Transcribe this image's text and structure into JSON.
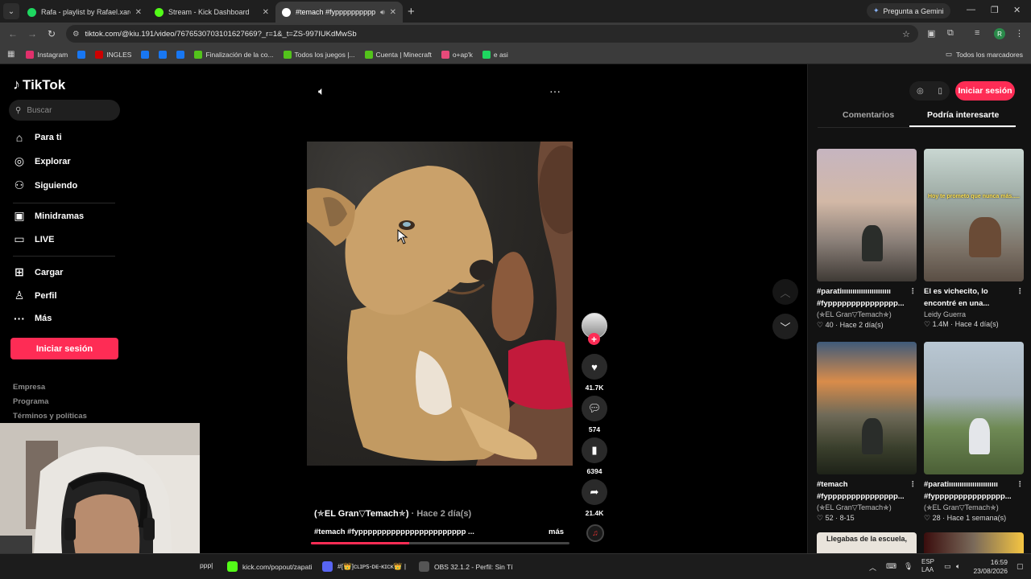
{
  "browser": {
    "tabs": [
      {
        "label": "Rafa - playlist by Rafael.xared |",
        "color": "#1ed760",
        "active": false
      },
      {
        "label": "Stream - Kick Dashboard",
        "color": "#53fc18",
        "active": false
      },
      {
        "label": "#temach #fypppppppppp",
        "color": "#ffffff",
        "active": true
      }
    ],
    "gemini_label": "Pregunta a Gemini",
    "url": "tiktok.com/@kiu.191/video/7676530703101627669?_r=1&_t=ZS-997IUKdMwSb",
    "profile_initial": "R",
    "bookmarks": [
      {
        "label": "Instagram",
        "color": "#e1306c"
      },
      {
        "label": "",
        "color": "#1877f2"
      },
      {
        "label": "INGLES",
        "color": "#cc0000"
      },
      {
        "label": "",
        "color": "#1877f2"
      },
      {
        "label": "",
        "color": "#1877f2"
      },
      {
        "label": "",
        "color": "#1877f2"
      },
      {
        "label": "Finalización de la co...",
        "color": "#53c31b"
      },
      {
        "label": "Todos los juegos |...",
        "color": "#53c31b"
      },
      {
        "label": "Cuenta | Minecraft",
        "color": "#53c31b"
      },
      {
        "label": "o+ap'k",
        "color": "#e84a7a"
      },
      {
        "label": "e asi",
        "color": "#1ed760"
      }
    ],
    "all_bookmarks": "Todos los marcadores"
  },
  "sidebar": {
    "logo": "TikTok",
    "search_placeholder": "Buscar",
    "nav": [
      {
        "label": "Para ti",
        "icon": "home-icon",
        "glyph": "⌂"
      },
      {
        "label": "Explorar",
        "icon": "compass-icon",
        "glyph": "◎"
      },
      {
        "label": "Siguiendo",
        "icon": "user-follow-icon",
        "glyph": "⚇"
      },
      {
        "label": "Minidramas",
        "icon": "film-icon",
        "glyph": "▣"
      },
      {
        "label": "LIVE",
        "icon": "live-tv-icon",
        "glyph": "▭"
      },
      {
        "label": "Cargar",
        "icon": "upload-icon",
        "glyph": "⊞"
      },
      {
        "label": "Perfil",
        "icon": "profile-icon",
        "glyph": "♙"
      },
      {
        "label": "Más",
        "icon": "more-icon",
        "glyph": "···"
      }
    ],
    "login": "Iniciar sesión",
    "footer": [
      "Empresa",
      "Programa",
      "Términos y políticas"
    ]
  },
  "video": {
    "author": "(✯EL Gran▽Temach✯)",
    "when": "· Hace 2 día(s)",
    "caption": "#temach #fyppppppppppppppppppppppp ...",
    "more": "más",
    "progress": 0.38,
    "likes": "41.7K",
    "comments": "574",
    "saves": "6394",
    "shares": "21.4K"
  },
  "right_panel": {
    "login": "Iniciar sesión",
    "tab_comments": "Comentarios",
    "tab_suggested": "Podría interesarte",
    "cards": [
      {
        "title": "#paratiııııııııııııııııııııııı #fyppppppppppppppp...",
        "author": "(✯EL Gran▽Temach✯)",
        "stats": "♡ 40 · Hace 2 día(s)",
        "overlay": "",
        "bg": "linear-gradient(180deg,#c6b5c0 0%,#d2b8a6 40%,#8a7f78 70%,#3f3a35 100%)"
      },
      {
        "title": "El es vichecito, lo encontré en una...",
        "author": "Leidy Guerra",
        "stats": "♡ 1.4M · Hace 4 día(s)",
        "overlay": "Hoy te prometo que nunca más.....",
        "bg": "linear-gradient(180deg,#c9d7d2 0%,#9aa7a0 40%,#7d7368 75%,#5a4e44 100%)"
      },
      {
        "title": "#temach #fyppppppppppppppp...",
        "author": "(✯EL Gran▽Temach✯)",
        "stats": "♡ 52 · 8-15",
        "overlay": "",
        "bg": "linear-gradient(180deg,#3f5a7a 0%,#d98c4a 30%,#6f6a58 55%,#3a3f2c 80%,#1e2218 100%)"
      },
      {
        "title": "#paratiııııııııııııııııııııııı #fyppppppppppppppp...",
        "author": "(✯EL Gran▽Temach✯)",
        "stats": "♡ 28 · Hace 1 semana(s)",
        "overlay": "",
        "bg": "linear-gradient(180deg,#b9c7d3 0%,#a6b3bb 40%,#6f8a55 65%,#4b5f36 100%)"
      }
    ],
    "peek_text": "Llegabas de la escuela,"
  },
  "taskbar": {
    "items": [
      {
        "label": "ppp|",
        "color": "#444"
      },
      {
        "label": "kick.com/popout/zapati",
        "color": "#53fc18"
      },
      {
        "label": "#[👑]ᴄʟɪᴘꜱ-ᴅᴇ-ᴋɪᴄᴋ👑 |",
        "color": "#5865f2"
      },
      {
        "label": "OBS 32.1.2 - Perfil: Sin Tí",
        "color": "#555"
      }
    ],
    "lang": "ESP",
    "lang2": "LAA",
    "time": "16:59",
    "date": "23/08/2026"
  }
}
